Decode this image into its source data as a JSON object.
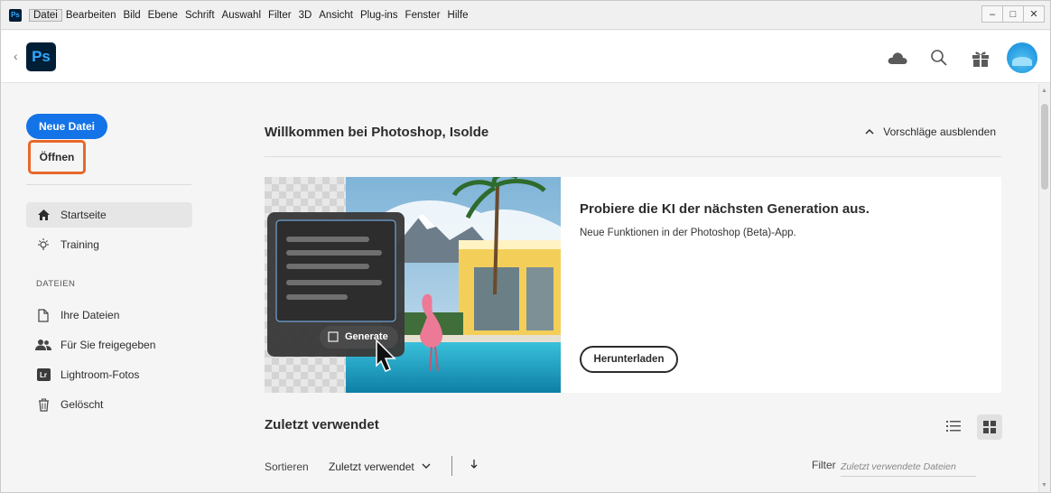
{
  "menu": {
    "items": [
      "Datei",
      "Bearbeiten",
      "Bild",
      "Ebene",
      "Schrift",
      "Auswahl",
      "Filter",
      "3D",
      "Ansicht",
      "Plug-ins",
      "Fenster",
      "Hilfe"
    ],
    "app_badge": "Ps"
  },
  "window_controls": {
    "minimize": "–",
    "maximize": "□",
    "close": "✕"
  },
  "header": {
    "back": "‹",
    "logo": "Ps"
  },
  "sidebar": {
    "new_file": "Neue Datei",
    "open": "Öffnen",
    "nav": [
      {
        "label": "Startseite",
        "icon": "home-icon"
      },
      {
        "label": "Training",
        "icon": "lightbulb-icon"
      }
    ],
    "section_files": "DATEIEN",
    "files": [
      {
        "label": "Ihre Dateien",
        "icon": "document-icon"
      },
      {
        "label": "Für Sie freigegeben",
        "icon": "shared-users-icon"
      },
      {
        "label": "Lightroom-Fotos",
        "icon": "lightroom-icon",
        "badge": "Lr"
      },
      {
        "label": "Gelöscht",
        "icon": "trash-icon"
      }
    ]
  },
  "main": {
    "welcome": "Willkommen bei Photoshop, Isolde",
    "hide_suggestions": "Vorschläge ausblenden",
    "card": {
      "title": "Probiere die KI der nächsten Generation aus.",
      "description": "Neue Funktionen in der Photoshop (Beta)-App.",
      "download": "Herunterladen",
      "generate_label": "Generate"
    },
    "recent": "Zuletzt verwendet",
    "sort_label": "Sortieren",
    "sort_value": "Zuletzt verwendet",
    "filter_label": "Filter",
    "filter_placeholder": "Zuletzt verwendete Dateien"
  },
  "colors": {
    "accent": "#1473e6",
    "highlight_box": "#e8682b",
    "ps_dark": "#001e36",
    "ps_blue": "#31a8ff"
  }
}
